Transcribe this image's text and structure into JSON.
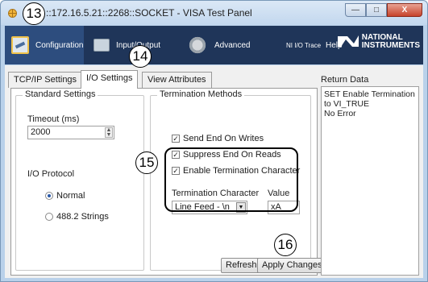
{
  "window": {
    "title": "::172.16.5.21::2268::SOCKET - VISA Test Panel",
    "controls": {
      "minimize": "—",
      "maximize": "□",
      "close": "X"
    }
  },
  "toolbar": {
    "items": [
      {
        "label": "Configuration",
        "icon": "configuration-icon"
      },
      {
        "label": "Input/Output",
        "icon": "monitor-icon"
      },
      {
        "label": "Advanced",
        "icon": "gear-icon"
      },
      {
        "label": "NI I/O Trace"
      },
      {
        "label": "Help"
      }
    ],
    "brand_line1": "NATIONAL",
    "brand_line2": "INSTRUMENTS"
  },
  "tabs": [
    {
      "label": "TCP/IP Settings"
    },
    {
      "label": "I/O Settings"
    },
    {
      "label": "View Attributes"
    }
  ],
  "standard_settings": {
    "title": "Standard Settings",
    "timeout_label": "Timeout (ms)",
    "timeout_value": "2000",
    "protocol_label": "I/O Protocol",
    "protocol_options": [
      {
        "label": "Normal",
        "selected": true
      },
      {
        "label": "488.2 Strings",
        "selected": false
      }
    ]
  },
  "termination": {
    "title": "Termination Methods",
    "send_end": {
      "label": "Send End On Writes",
      "checked": true
    },
    "suppress_end": {
      "label": "Suppress End On Reads",
      "checked": true
    },
    "enable_term_char": {
      "label": "Enable Termination Character",
      "checked": true
    },
    "term_char_label": "Termination Character",
    "term_char_value": "Line Feed - \\n",
    "value_label": "Value",
    "value_value": "xA"
  },
  "buttons": {
    "refresh": "Refresh",
    "apply": "Apply Changes"
  },
  "return_data": {
    "label": "Return Data",
    "lines": [
      "SET Enable Termination",
      "to VI_TRUE",
      "No Error"
    ]
  },
  "callouts": [
    "13",
    "14",
    "15",
    "16"
  ],
  "colors": {
    "toolbar_bg": "#1f3559",
    "titlebar": "#c2d7ee",
    "close_button": "#c7432b"
  }
}
